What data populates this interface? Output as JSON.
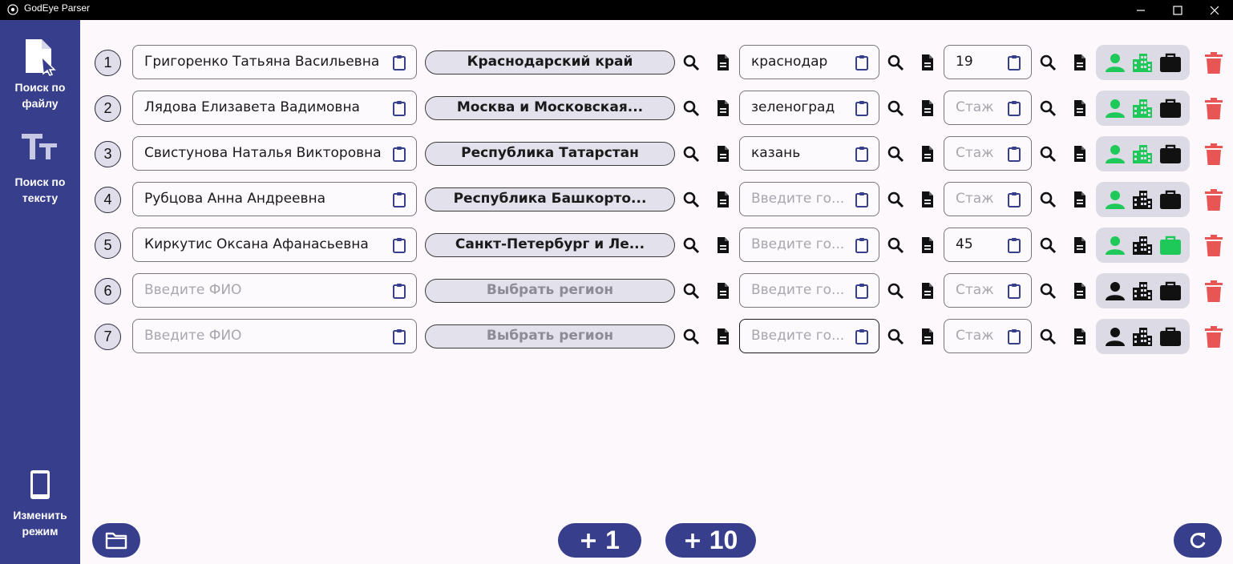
{
  "window": {
    "title": "GodEye Parser"
  },
  "sidebar": {
    "search_file_label": "Поиск по файлу",
    "search_text_label": "Поиск по тексту",
    "change_mode_label": "Изменить режим"
  },
  "placeholders": {
    "fio": "Введите ФИО",
    "region": "Выбрать регион",
    "city": "Введите го...",
    "stazh": "Стаж"
  },
  "rows": [
    {
      "num": "1",
      "fio": "Григоренко Татьяна Васильевна",
      "region": "Краснодарский край",
      "city": "краснодар",
      "stazh": "19",
      "person_active": true,
      "company_active": true,
      "work_active": false
    },
    {
      "num": "2",
      "fio": "Лядова Елизавета Вадимовна",
      "region": "Москва и Московская...",
      "city": "зеленоград",
      "stazh": "",
      "person_active": true,
      "company_active": true,
      "work_active": false
    },
    {
      "num": "3",
      "fio": "Свистунова Наталья Викторовна",
      "region": "Республика Татарстан",
      "city": "казань",
      "stazh": "",
      "person_active": true,
      "company_active": true,
      "work_active": false
    },
    {
      "num": "4",
      "fio": "Рубцова Анна Андреевна",
      "region": "Республика Башкорто...",
      "city": "",
      "stazh": "",
      "person_active": true,
      "company_active": false,
      "work_active": false
    },
    {
      "num": "5",
      "fio": "Киркутис Оксана Афанасьевна",
      "region": "Санкт-Петербург и Ле...",
      "city": "",
      "stazh": "45",
      "person_active": true,
      "company_active": false,
      "work_active": true
    },
    {
      "num": "6",
      "fio": "",
      "region": "",
      "city": "",
      "stazh": "",
      "person_active": false,
      "company_active": false,
      "work_active": false
    },
    {
      "num": "7",
      "fio": "",
      "region": "",
      "city": "",
      "stazh": "",
      "person_active": false,
      "company_active": false,
      "work_active": false,
      "city_focused": true
    }
  ],
  "bottom": {
    "add_one_label": "1",
    "add_ten_label": "10"
  },
  "colors": {
    "accent": "#373e8b",
    "active_green": "#1ec95a",
    "delete_red": "#e85555",
    "inactive_black": "#111111"
  }
}
